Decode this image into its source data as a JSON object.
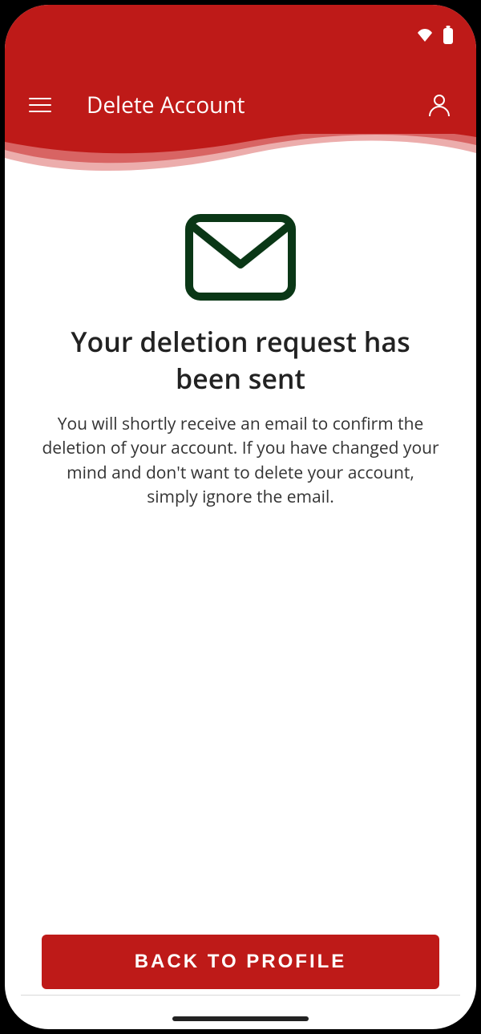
{
  "colors": {
    "brand": "#be1a18",
    "brand_light1": "#d86463",
    "brand_light2": "#ecadac",
    "icon_dark": "#0a3716"
  },
  "header": {
    "title": "Delete Account"
  },
  "icons": {
    "menu": "menu-icon",
    "profile": "profile-icon",
    "wifi": "wifi-icon",
    "battery": "battery-icon",
    "mail": "mail-icon"
  },
  "main": {
    "heading": "Your deletion request has been sent",
    "body": "You will shortly receive an email to confirm the deletion of your account. If you have changed your mind and don't want to delete your account, simply ignore the email."
  },
  "button": {
    "label": "BACK TO PROFILE"
  }
}
